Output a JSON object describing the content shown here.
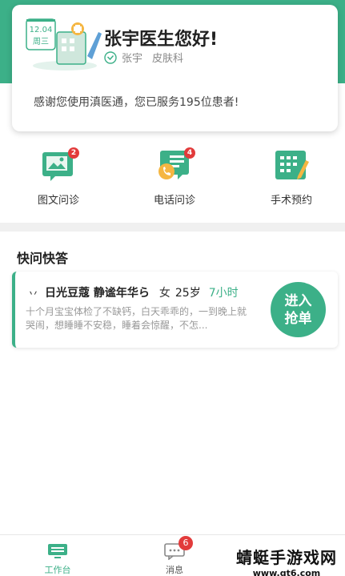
{
  "colors": {
    "brand": "#3cb088",
    "badge": "#e23b3b"
  },
  "calendar": {
    "date": "12.04",
    "weekday": "周三"
  },
  "doctor": {
    "greeting": "张宇医生您好!",
    "name": "张宇",
    "department": "皮肤科",
    "thanks": "感谢您使用滇医通，您已服务195位患者!"
  },
  "actions": [
    {
      "label": "图文问诊",
      "badge": "2",
      "icon": "image-chat-icon"
    },
    {
      "label": "电话问诊",
      "badge": "4",
      "icon": "phone-chat-icon"
    },
    {
      "label": "手术预约",
      "badge": "",
      "icon": "surgery-calendar-icon"
    }
  ],
  "quick_qa": {
    "title": "快问快答",
    "item": {
      "mark": "丷",
      "name": "日光豆蔻 静谧年华ら",
      "gender": "女",
      "age": "25岁",
      "time": "7小时",
      "content": "十个月宝宝体检了不缺钙，白天乖乖的，一到晚上就哭闹，想睡睡不安稳，睡着会惊醒，不怎...",
      "button_line1": "进入",
      "button_line2": "抢单"
    }
  },
  "tabbar": {
    "tabs": [
      {
        "label": "工作台",
        "active": true,
        "icon": "workbench-icon"
      },
      {
        "label": "消息",
        "badge": "6",
        "icon": "message-icon"
      }
    ]
  },
  "watermark": {
    "line1": "蜻蜓手游戏网",
    "line2": "www.qt6.com"
  }
}
